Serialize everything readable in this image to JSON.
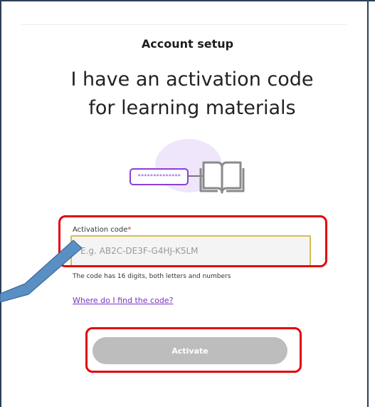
{
  "header": {
    "subtitle": "Account setup"
  },
  "hero": {
    "title_line1": "I have an activation code",
    "title_line2": "for learning materials"
  },
  "illustration": {
    "code_mask": "**************",
    "icons": [
      "code-pill-icon",
      "book-icon"
    ],
    "accent_color": "#8b3fd8"
  },
  "form": {
    "label": "Activation code",
    "required_mark": "*",
    "placeholder": "E.g. AB2C-DE3F-G4HJ-K5LM",
    "value": "",
    "hint": "The code has 16 digits, both letters and numbers"
  },
  "help": {
    "link_label": "Where do I find the code?"
  },
  "actions": {
    "activate_label": "Activate",
    "activate_color": "#bdbdbd"
  },
  "annotations": {
    "highlight_color": "#e3050f",
    "arrow_color": "#5a8fc4"
  }
}
